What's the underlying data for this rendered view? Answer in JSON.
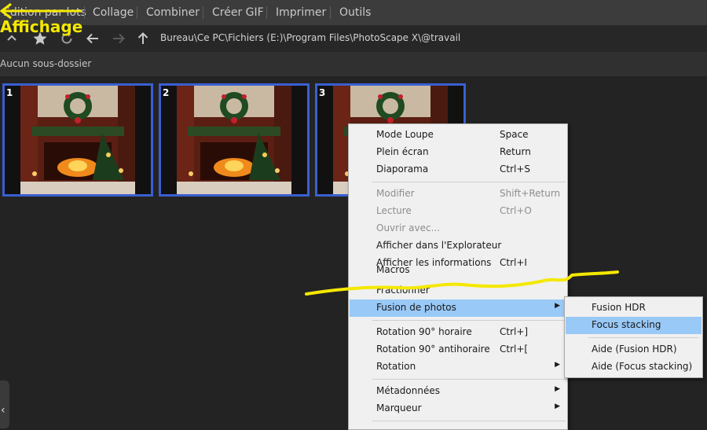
{
  "menubar": {
    "items": [
      {
        "label": "Edition par lots",
        "color": "#c9c9c9"
      },
      {
        "label": "Collage"
      },
      {
        "label": "Combiner"
      },
      {
        "label": "Créer GIF"
      },
      {
        "label": "Imprimer"
      },
      {
        "label": "Outils"
      }
    ]
  },
  "annotation": {
    "label": "Affichage",
    "color": "#f5e800"
  },
  "toolbar": {
    "icons": [
      "up-icon",
      "star-icon",
      "refresh-icon",
      "back-icon",
      "forward-icon",
      "parent-folder-icon"
    ],
    "path": "Bureau\\Ce PC\\Fichiers (E:)\\Program Files\\PhotoScape X\\@travail"
  },
  "subfolders": {
    "label": "Aucun sous-dossier"
  },
  "thumbnails": [
    {
      "number": "1"
    },
    {
      "number": "2"
    },
    {
      "number": "3"
    }
  ],
  "context_menu": {
    "items": [
      {
        "label": "Mode Loupe",
        "shortcut": "Space"
      },
      {
        "label": "Plein écran",
        "shortcut": "Return"
      },
      {
        "label": "Diaporama",
        "shortcut": "Ctrl+S"
      },
      {
        "label": "Modifier",
        "shortcut": "Shift+Return",
        "disabled": true
      },
      {
        "label": "Lecture",
        "shortcut": "Ctrl+O",
        "disabled": true
      },
      {
        "label": "Ouvrir avec...",
        "shortcut": "",
        "disabled": true
      },
      {
        "label": "Afficher dans l'Explorateur",
        "shortcut": ""
      },
      {
        "label": "Afficher les informations",
        "shortcut": "Ctrl+I"
      },
      {
        "label": "Macros",
        "shortcut": ""
      },
      {
        "label": "Fractionner",
        "shortcut": ""
      },
      {
        "label": "Fusion de photos",
        "shortcut": "",
        "submenu": true,
        "highlighted": true
      },
      {
        "label": "Rotation 90° horaire",
        "shortcut": "Ctrl+]"
      },
      {
        "label": "Rotation 90° antihoraire",
        "shortcut": "Ctrl+["
      },
      {
        "label": "Rotation",
        "shortcut": "",
        "submenu": true
      },
      {
        "label": "Métadonnées",
        "shortcut": "",
        "submenu": true
      },
      {
        "label": "Marqueur",
        "shortcut": "",
        "submenu": true
      }
    ]
  },
  "submenu": {
    "items": [
      {
        "label": "Fusion HDR"
      },
      {
        "label": "Focus stacking",
        "highlighted": true
      },
      {
        "label": "Aide (Fusion HDR)"
      },
      {
        "label": "Aide (Focus stacking)"
      }
    ]
  },
  "colors": {
    "highlight": "#99c9f7",
    "thumb_border": "#3a5fd0",
    "annotation": "#f5e800"
  }
}
